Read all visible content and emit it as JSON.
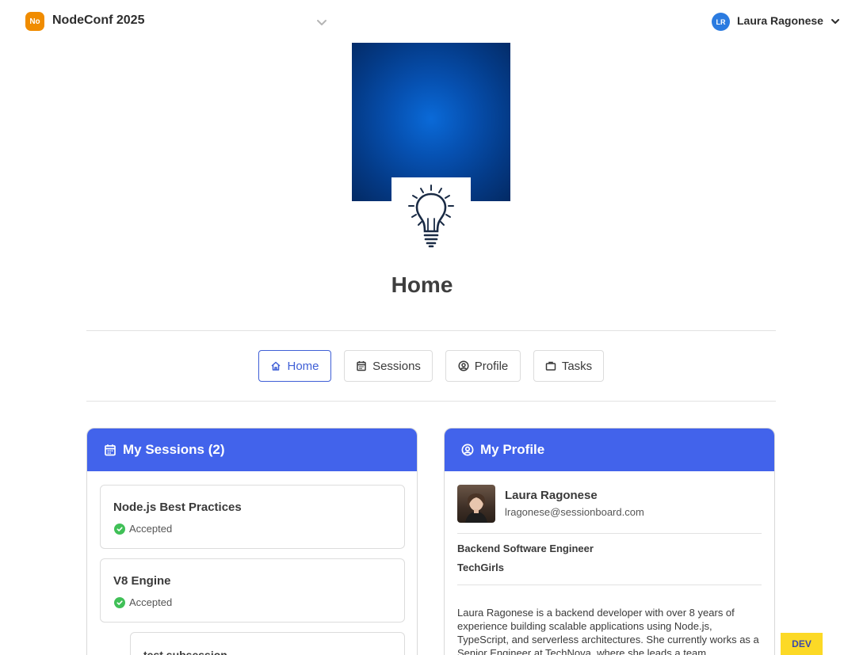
{
  "topbar": {
    "event_badge": "No",
    "event_name": "NodeConf 2025",
    "user_initials": "LR",
    "user_name": "Laura Ragonese"
  },
  "page": {
    "title": "Home"
  },
  "tabs": [
    {
      "label": "Home",
      "icon": "home-icon",
      "active": true
    },
    {
      "label": "Sessions",
      "icon": "calendar-icon",
      "active": false
    },
    {
      "label": "Profile",
      "icon": "user-circle-icon",
      "active": false
    },
    {
      "label": "Tasks",
      "icon": "briefcase-icon",
      "active": false
    }
  ],
  "sessions_card": {
    "title": "My Sessions (2)",
    "sessions": [
      {
        "title": "Node.js Best Practices",
        "status": "Accepted"
      },
      {
        "title": "V8 Engine",
        "status": "Accepted"
      }
    ],
    "sub_session": "test subsession"
  },
  "profile_card": {
    "title": "My Profile",
    "name": "Laura Ragonese",
    "email": "lragonese@sessionboard.com",
    "role": "Backend Software Engineer",
    "company": "TechGirls",
    "bio": "Laura Ragonese is a backend developer with over 8 years of experience building scalable applications using Node.js, TypeScript, and serverless architectures. She currently works as a Senior Engineer at TechNova, where she leads a team"
  },
  "env_badge": "DEV",
  "colors": {
    "accent": "#4263eb",
    "event_badge": "#f08c00",
    "avatar": "#2b7be0",
    "status_accepted": "#40c057",
    "dev_badge": "#fcd926"
  }
}
